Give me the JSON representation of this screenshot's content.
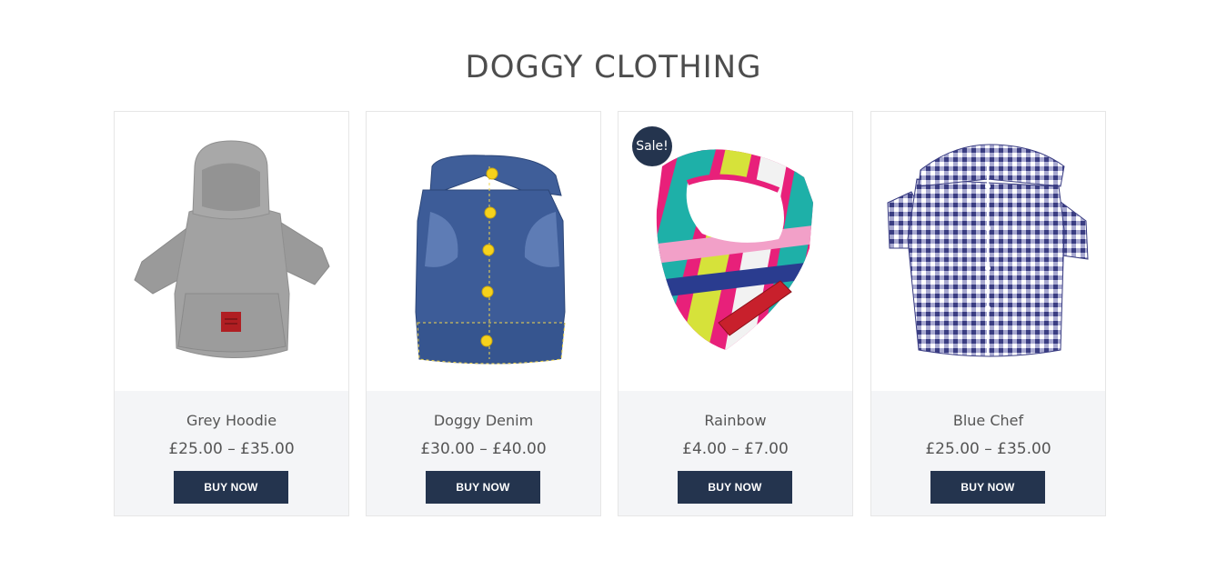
{
  "section": {
    "title": "DOGGY CLOTHING"
  },
  "products": [
    {
      "name": "Grey Hoodie",
      "price": "£25.00 – £35.00",
      "button_label": "BUY NOW",
      "image_icon": "grey-hoodie-image"
    },
    {
      "name": "Doggy Denim",
      "price": "£30.00 – £40.00",
      "button_label": "BUY NOW",
      "image_icon": "denim-jacket-image"
    },
    {
      "name": "Rainbow",
      "price": "£4.00 – £7.00",
      "button_label": "BUY NOW",
      "badge": "Sale!",
      "image_icon": "rainbow-bandana-image"
    },
    {
      "name": "Blue Chef",
      "price": "£25.00 – £35.00",
      "button_label": "BUY NOW",
      "image_icon": "gingham-shirt-image"
    }
  ],
  "colors": {
    "button_bg": "#24344e",
    "info_bg": "#f4f5f7",
    "title_text": "#4d4d4d",
    "body_text": "#555555"
  }
}
